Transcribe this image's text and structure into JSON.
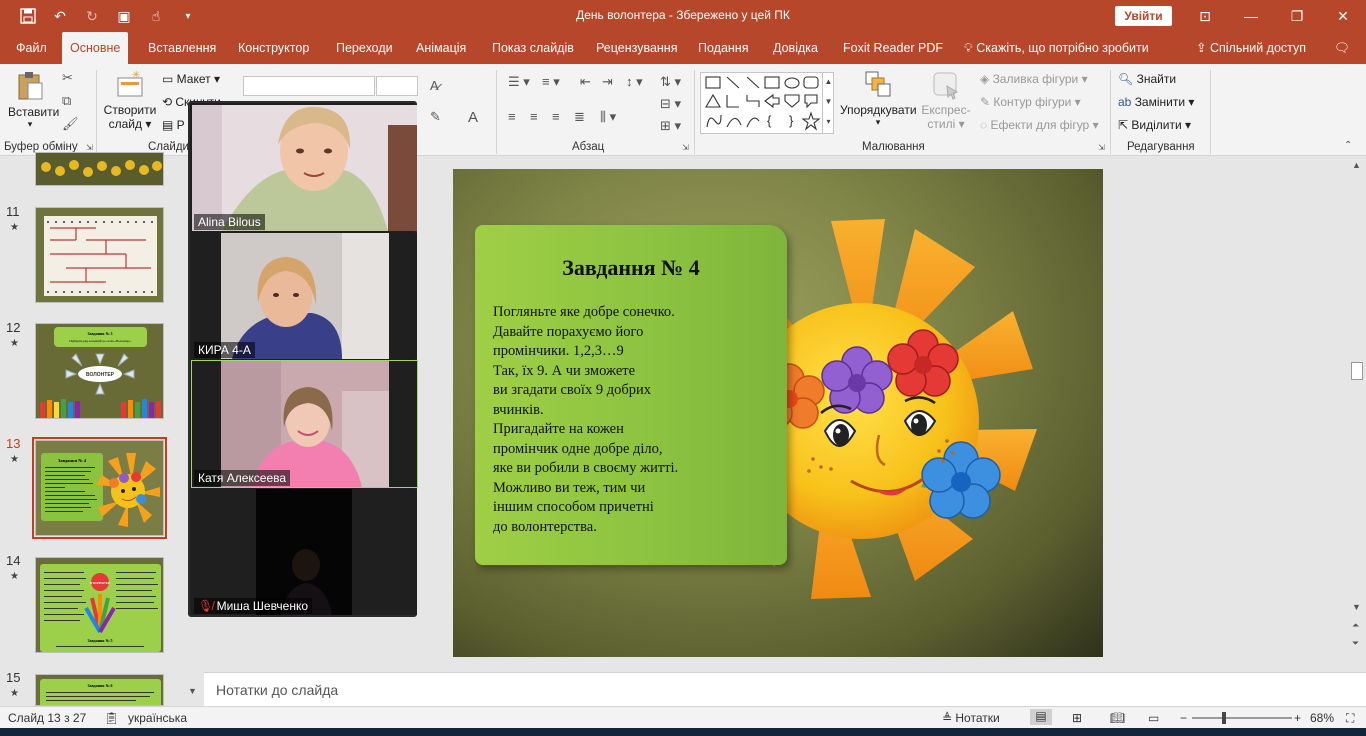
{
  "titlebar": {
    "title": "День волонтера  -  Збережено у цей ПК",
    "signin": "Увійти",
    "qat": [
      "save-icon",
      "undo-icon",
      "redo-icon",
      "present-icon",
      "touch-icon",
      "customize-icon"
    ],
    "background": "#b7472a"
  },
  "tabs": {
    "items": [
      "Файл",
      "Основне",
      "Вставлення",
      "Конструктор",
      "Переходи",
      "Анімація",
      "Показ слайдів",
      "Рецензування",
      "Подання",
      "Довідка",
      "Foxit Reader PDF",
      "Скажіть, що потрібно зробити"
    ],
    "active": "Основне",
    "share": "Спільний доступ"
  },
  "ribbon": {
    "clipboard": {
      "paste": "Вставити",
      "group": "Буфер обміну"
    },
    "slides": {
      "new_slide_1": "Створити",
      "new_slide_2": "слайд",
      "layout": "Макет",
      "reset": "Скинути",
      "section": "Р",
      "group": "Слайди"
    },
    "paragraph": {
      "group": "Абзац"
    },
    "drawing": {
      "arrange": "Упорядкувати",
      "quick_styles_1": "Експрес-",
      "quick_styles_2": "стилі",
      "fill": "Заливка фігури",
      "outline": "Контур фігури",
      "effects": "Ефекти для фігур",
      "group": "Малювання"
    },
    "editing": {
      "find": "Знайти",
      "replace": "Замінити",
      "select": "Виділити",
      "group": "Редагування"
    }
  },
  "thumbnails": [
    {
      "num": "11",
      "star": "★"
    },
    {
      "num": "12",
      "star": "★",
      "title": "Завдання № 3",
      "caption": "Підберіть ряд асоціацій до слова «Волонтер»",
      "center": "ВОЛОНТЕР"
    },
    {
      "num": "13",
      "star": "★",
      "selected": true,
      "title": "Завдання № 4"
    },
    {
      "num": "14",
      "star": "★",
      "badge": "Я ВОЛОНТЕР",
      "subtitle": "Завдання № 5"
    },
    {
      "num": "15",
      "star": "★",
      "title": "Завдання № 6"
    }
  ],
  "zoom": {
    "participants": [
      {
        "name": "Alina Bilous",
        "muted": false
      },
      {
        "name": "КИРА 4-А",
        "muted": false
      },
      {
        "name": "Катя Алексеева",
        "muted": false,
        "active": true
      },
      {
        "name": "Миша Шевченко",
        "muted": true
      }
    ]
  },
  "slide": {
    "title": "Завдання № 4",
    "lines": [
      "Погляньте яке добре сонечко.",
      "Давайте порахуємо його",
      "промінчики. 1,2,3…9",
      "Так, їх 9. А чи зможете",
      "ви згадати своїх 9 добрих",
      "вчинків.",
      "Пригадайте на кожен",
      "промінчик одне добре діло,",
      "яке ви робили в своєму житті.",
      "Можливо ви теж, тим чи",
      "іншим способом причетні",
      "до волонтерства."
    ],
    "ray_count": 9,
    "colors": {
      "panel": "#8bc240",
      "sun": "#f5a11d",
      "face": "#f5c21a"
    }
  },
  "notes": {
    "placeholder": "Нотатки до слайда"
  },
  "status": {
    "slide_counter": "Слайд 13 з 27",
    "language": "українська",
    "notes_button": "Нотатки",
    "zoom": "68%",
    "zoom_fraction": 0.68
  }
}
